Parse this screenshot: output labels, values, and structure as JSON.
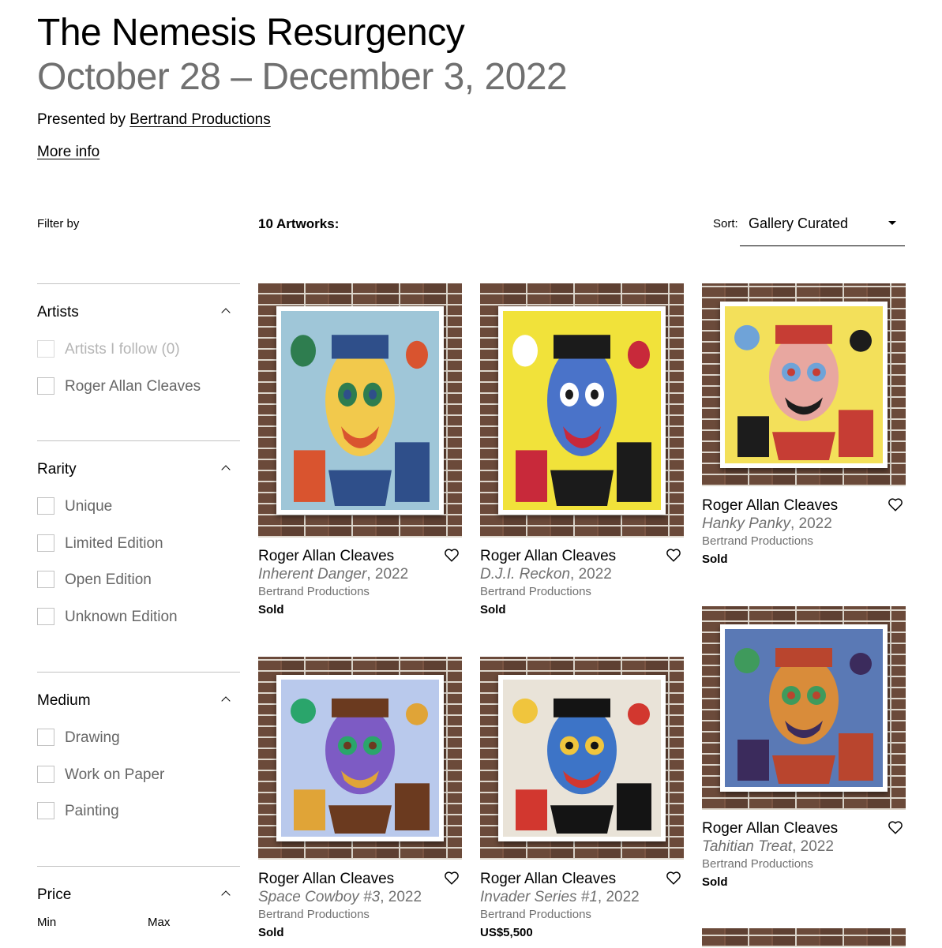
{
  "show": {
    "title": "The Nemesis Resurgency",
    "dates": "October 28 – December 3, 2022",
    "presented_prefix": "Presented by ",
    "presenter": "Bertrand Productions",
    "more_info": "More info"
  },
  "toolbar": {
    "filter_by": "Filter by",
    "count": "10 Artworks:",
    "sort_label": "Sort:",
    "sort_value": "Gallery Curated"
  },
  "filters": {
    "artists": {
      "label": "Artists",
      "options": [
        "Artists I follow (0)",
        "Roger Allan Cleaves"
      ]
    },
    "rarity": {
      "label": "Rarity",
      "options": [
        "Unique",
        "Limited Edition",
        "Open Edition",
        "Unknown Edition"
      ]
    },
    "medium": {
      "label": "Medium",
      "options": [
        "Drawing",
        "Work on Paper",
        "Painting"
      ]
    },
    "price": {
      "label": "Price",
      "min": "Min",
      "max": "Max"
    }
  },
  "artworks": [
    {
      "artist": "Roger Allan Cleaves",
      "title": "Inherent Danger",
      "year": ", 2022",
      "gallery": "Bertrand Productions",
      "status": "Sold",
      "icon": "heart-icon",
      "palette": {
        "bg": "#9fc6d8",
        "a": "#2f4f8a",
        "b": "#d9542f",
        "c": "#f2c94c",
        "d": "#2e7d4f"
      }
    },
    {
      "artist": "Roger Allan Cleaves",
      "title": "D.J.I. Reckon",
      "year": ", 2022",
      "gallery": "Bertrand Productions",
      "status": "Sold",
      "icon": "heart-icon",
      "palette": {
        "bg": "#f1e23a",
        "a": "#1b1b1b",
        "b": "#c8293a",
        "c": "#4a73c9",
        "d": "#ffffff"
      }
    },
    {
      "artist": "Roger Allan Cleaves",
      "title": "Hanky Panky",
      "year": ", 2022",
      "gallery": "Bertrand Productions",
      "status": "Sold",
      "icon": "heart-icon",
      "palette": {
        "bg": "#f3e05a",
        "a": "#c63d34",
        "b": "#1c1c1c",
        "c": "#e8a7a0",
        "d": "#6fa3d8"
      }
    },
    {
      "artist": "Roger Allan Cleaves",
      "title": "Space Cowboy #3",
      "year": ", 2022",
      "gallery": "Bertrand Productions",
      "status": "Sold",
      "icon": "heart-icon",
      "palette": {
        "bg": "#b9c9ec",
        "a": "#6b3a1f",
        "b": "#e0a437",
        "c": "#7d5bc4",
        "d": "#2aa56b"
      }
    },
    {
      "artist": "Roger Allan Cleaves",
      "title": "Invader Series #1",
      "year": ", 2022",
      "gallery": "Bertrand Productions",
      "status": "US$5,500",
      "icon": "heart-icon",
      "palette": {
        "bg": "#e9e3d8",
        "a": "#141414",
        "b": "#d2372f",
        "c": "#3d74c7",
        "d": "#f0c53d"
      }
    },
    {
      "artist": "Roger Allan Cleaves",
      "title": "Tahitian Treat",
      "year": ", 2022",
      "gallery": "Bertrand Productions",
      "status": "Sold",
      "icon": "heart-icon",
      "palette": {
        "bg": "#5a79b5",
        "a": "#b9452e",
        "b": "#3b2b5c",
        "c": "#d98c3a",
        "d": "#3f9a5c"
      }
    }
  ]
}
